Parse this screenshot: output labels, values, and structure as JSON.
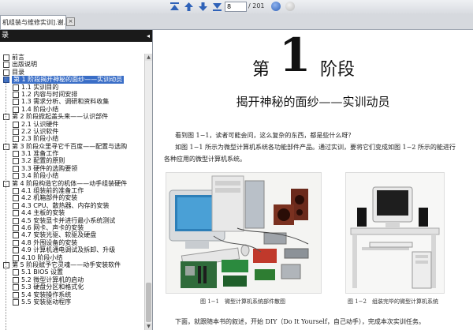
{
  "toolbar": {
    "current_page": "8",
    "total_pages": "/ 201",
    "icons": [
      "first-page-icon",
      "previous-page-icon",
      "next-page-icon",
      "last-page-icon",
      "go-icon",
      "stop-icon"
    ]
  },
  "tab": {
    "title": "机组装与维修实训].谢...",
    "close": "×"
  },
  "sidebar": {
    "title": "录",
    "collapse": "◂",
    "items": [
      "前言",
      "出版说明",
      "目录",
      "第 1 阶段揭开神秘的面纱——实训动员",
      "1.1 实训目的",
      "1.2 内容与时间安排",
      "1.3 需求分析、调研和资料收集",
      "1.4 阶段小结",
      "第 2 阶段掀起盖头来——认识部件",
      "2.1 认识硬件",
      "2.2 认识软件",
      "2.3 阶段小结",
      "第 3 阶段众里寻它千百度——配置与选购",
      "3.1 准备工作",
      "3.2 配置的原则",
      "3.3 硬件的选购要领",
      "3.4 阶段小结",
      "第 4 阶段构造它的机体——动手组装硬件",
      "4.1 组装前的准备工作",
      "4.2 机箱部件的安装",
      "4.3 CPU、散热器、内存的安装",
      "4.4 主板的安装",
      "4.5 安装显卡并进行最小系统测试",
      "4.6 网卡、声卡的安装",
      "4.7 安装光驱、软驱及硬盘",
      "4.8 外围设备的安装",
      "4.9 计算机通电调试及拆卸、升级",
      "4.10 阶段小结",
      "第 5 阶段赋予它灵魂——动手安装软件",
      "5.1 BIOS 设置",
      "5.2 微型计算机的启动",
      "5.3 硬盘分区和格式化",
      "5.4 安装操作系统",
      "5.5 安装驱动程序"
    ],
    "selected_index": 3
  },
  "document": {
    "chapter_prefix": "第",
    "chapter_number": "1",
    "chapter_suffix": "阶段",
    "chapter_title": "揭开神秘的面纱——实训动员",
    "para1": "看到图 1−1，读者可能会问，这么复杂的东西，都是些什么呀？",
    "para2": "如图 1−1 所示为微型计算机系统各功能部件产品。通过实训，要将它们变成如图 1−2 所示的能进行各种应用的微型计算机系统。",
    "caption1": "图 1−1　微型计算机系统部件散图",
    "caption2": "图 1−2　组装完毕的微型计算机系统",
    "para3": "下面，就跟随本书的叙述，开始 DIY（Do It Yourself，自己动手），完成本次实训任务。"
  },
  "colors": {
    "accent": "#3a6ec7",
    "toolbar_icon": "#2f62b8",
    "sidebar_header": "#1a1a1a"
  }
}
